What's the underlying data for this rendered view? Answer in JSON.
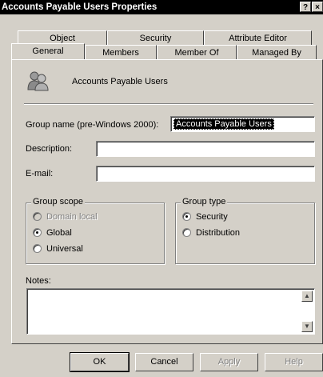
{
  "window": {
    "title": "Accounts Payable Users Properties",
    "help_glyph": "?",
    "close_glyph": "×"
  },
  "tabs": {
    "row1": [
      "Object",
      "Security",
      "Attribute Editor"
    ],
    "row2": [
      "General",
      "Members",
      "Member Of",
      "Managed By"
    ],
    "active": "General"
  },
  "general": {
    "group_icon": "group-users-icon",
    "group_display_name": "Accounts Payable Users",
    "fields": {
      "group_name_label": "Group name (pre-Windows 2000):",
      "group_name_value": "Accounts Payable Users",
      "description_label": "Description:",
      "description_value": "",
      "email_label": "E-mail:",
      "email_value": ""
    },
    "group_scope": {
      "legend": "Group scope",
      "options": [
        "Domain local",
        "Global",
        "Universal"
      ],
      "selected": "Global",
      "disabled": [
        "Domain local"
      ]
    },
    "group_type": {
      "legend": "Group type",
      "options": [
        "Security",
        "Distribution"
      ],
      "selected": "Security"
    },
    "notes_label": "Notes:",
    "notes_value": ""
  },
  "buttons": {
    "ok": "OK",
    "cancel": "Cancel",
    "apply": "Apply",
    "help": "Help"
  }
}
